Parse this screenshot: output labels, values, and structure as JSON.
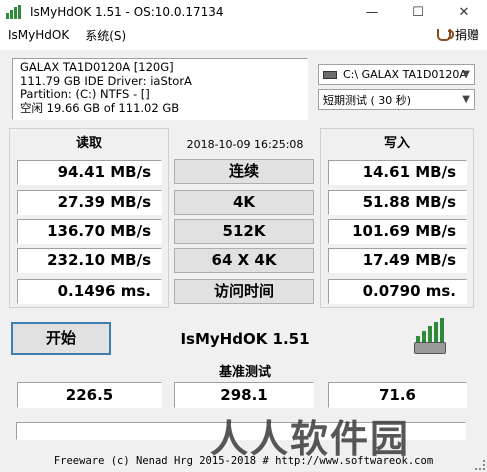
{
  "window": {
    "title": "IsMyHdOK 1.51 - OS:10.0.17134",
    "controls": {
      "minimize": "—",
      "maximize": "☐",
      "close": "✕"
    }
  },
  "menu": {
    "items": [
      "IsMyHdOK",
      "系统(S)"
    ],
    "donate_label": "捐赠"
  },
  "drive_info": {
    "line1": "GALAX TA1D0120A [120G]",
    "line2": "111.79 GB  IDE Driver: iaStorA",
    "line3": "Partition: (C:) NTFS - []",
    "line4": "空闲 19.66 GB of 111.02 GB"
  },
  "drive_select": {
    "value": "C:\\ GALAX TA1D0120A"
  },
  "test_select": {
    "value": "短期测试 ( 30 秒)"
  },
  "timestamp": "2018-10-09 16:25:08",
  "read": {
    "header": "读取",
    "values": [
      "94.41 MB/s",
      "27.39 MB/s",
      "136.70 MB/s",
      "232.10 MB/s",
      "0.1496 ms."
    ]
  },
  "tests": {
    "labels": [
      "连续",
      "4K",
      "512K",
      "64 X 4K",
      "访问时间"
    ]
  },
  "write": {
    "header": "写入",
    "values": [
      "14.61 MB/s",
      "51.88 MB/s",
      "101.69 MB/s",
      "17.49 MB/s",
      "0.0790 ms."
    ]
  },
  "start_label": "开始",
  "app_name": "IsMyHdOK 1.51",
  "benchmark": {
    "title": "基准测试",
    "scores": [
      "226.5",
      "298.1",
      "71.6"
    ]
  },
  "footer": "Freeware (c) Nenad Hrg 2015-2018 # http://www.softwareok.com",
  "watermark": "人人软件园",
  "colors": {
    "accent": "#3c7fb1",
    "logo_green": "#2e8b3a"
  }
}
